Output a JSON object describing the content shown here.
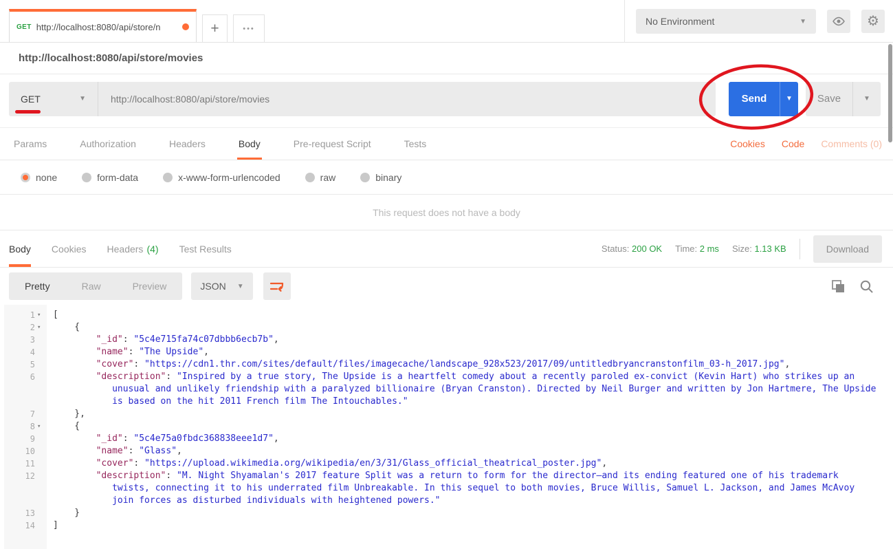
{
  "header": {
    "tab": {
      "method": "GET",
      "title": "http://localhost:8080/api/store/n",
      "unsaved_dot": true
    },
    "new_tab_label": "+",
    "more_tabs_label": "•••",
    "environment": {
      "selected": "No Environment"
    }
  },
  "breadcrumb": {
    "url": "http://localhost:8080/api/store/movies"
  },
  "request": {
    "method": "GET",
    "url": "http://localhost:8080/api/store/movies",
    "send_label": "Send",
    "save_label": "Save",
    "tabs": [
      {
        "label": "Params",
        "active": false
      },
      {
        "label": "Authorization",
        "active": false
      },
      {
        "label": "Headers",
        "active": false
      },
      {
        "label": "Body",
        "active": true
      },
      {
        "label": "Pre-request Script",
        "active": false
      },
      {
        "label": "Tests",
        "active": false
      }
    ],
    "meta_links": [
      {
        "label": "Cookies",
        "dim": false
      },
      {
        "label": "Code",
        "dim": false
      },
      {
        "label": "Comments (0)",
        "dim": true
      }
    ],
    "body_types": [
      {
        "label": "none",
        "selected": true
      },
      {
        "label": "form-data",
        "selected": false
      },
      {
        "label": "x-www-form-urlencoded",
        "selected": false
      },
      {
        "label": "raw",
        "selected": false
      },
      {
        "label": "binary",
        "selected": false
      }
    ],
    "empty_body_message": "This request does not have a body"
  },
  "response": {
    "tabs": [
      {
        "label": "Body",
        "count": "",
        "active": true
      },
      {
        "label": "Cookies",
        "count": "",
        "active": false
      },
      {
        "label": "Headers",
        "count": "(4)",
        "active": false
      },
      {
        "label": "Test Results",
        "count": "",
        "active": false
      }
    ],
    "status": {
      "label": "Status:",
      "value": "200 OK"
    },
    "time": {
      "label": "Time:",
      "value": "2 ms"
    },
    "size": {
      "label": "Size:",
      "value": "1.13 KB"
    },
    "download_label": "Download",
    "views": [
      {
        "label": "Pretty",
        "active": true
      },
      {
        "label": "Raw",
        "active": false
      },
      {
        "label": "Preview",
        "active": false
      }
    ],
    "format": "JSON"
  },
  "icons": {
    "environment_quicklook": "eye-icon",
    "settings": "gear-icon",
    "wrap_text": "wrap-text-icon",
    "copy": "copy-icon",
    "search": "search-icon"
  },
  "annotations": {
    "red_circle_target": "send-button",
    "red_underline_target": "method-select"
  },
  "colors": {
    "accent_orange": "#ff6c37",
    "send_blue": "#2b6fe3",
    "success_green": "#2ba143",
    "annotation_red": "#e0161f",
    "code_key": "#96265c",
    "code_string": "#2929cd"
  },
  "code": {
    "lines": [
      {
        "n": 1,
        "fold": true,
        "ind": 0,
        "cont": false,
        "t": [
          [
            "p",
            "["
          ]
        ]
      },
      {
        "n": 2,
        "fold": true,
        "ind": 4,
        "cont": false,
        "t": [
          [
            "p",
            "{"
          ]
        ]
      },
      {
        "n": 3,
        "fold": false,
        "ind": 8,
        "cont": false,
        "t": [
          [
            "k",
            "\"_id\""
          ],
          [
            "p",
            ": "
          ],
          [
            "s",
            "\"5c4e715fa74c07dbbb6ecb7b\""
          ],
          [
            "p",
            ","
          ]
        ]
      },
      {
        "n": 4,
        "fold": false,
        "ind": 8,
        "cont": false,
        "t": [
          [
            "k",
            "\"name\""
          ],
          [
            "p",
            ": "
          ],
          [
            "s",
            "\"The Upside\""
          ],
          [
            "p",
            ","
          ]
        ]
      },
      {
        "n": 5,
        "fold": false,
        "ind": 8,
        "cont": false,
        "t": [
          [
            "k",
            "\"cover\""
          ],
          [
            "p",
            ": "
          ],
          [
            "s",
            "\"https://cdn1.thr.com/sites/default/files/imagecache/landscape_928x523/2017/09/untitledbryancranstonfilm_03-h_2017.jpg\""
          ],
          [
            "p",
            ","
          ]
        ]
      },
      {
        "n": 6,
        "fold": false,
        "ind": 8,
        "cont": true,
        "t": [
          [
            "k",
            "\"description\""
          ],
          [
            "p",
            ": "
          ],
          [
            "s",
            "\"Inspired by a true story, The Upside is a heartfelt comedy about a recently paroled ex-convict (Kevin Hart) who strikes up an unusual and unlikely friendship with a paralyzed billionaire (Bryan Cranston). Directed by Neil Burger and written by Jon Hartmere, The Upside is based on the hit 2011 French film The Intouchables.\""
          ]
        ]
      },
      {
        "n": 7,
        "fold": false,
        "ind": 4,
        "cont": false,
        "t": [
          [
            "p",
            "},"
          ]
        ]
      },
      {
        "n": 8,
        "fold": true,
        "ind": 4,
        "cont": false,
        "t": [
          [
            "p",
            "{"
          ]
        ]
      },
      {
        "n": 9,
        "fold": false,
        "ind": 8,
        "cont": false,
        "t": [
          [
            "k",
            "\"_id\""
          ],
          [
            "p",
            ": "
          ],
          [
            "s",
            "\"5c4e75a0fbdc368838eee1d7\""
          ],
          [
            "p",
            ","
          ]
        ]
      },
      {
        "n": 10,
        "fold": false,
        "ind": 8,
        "cont": false,
        "t": [
          [
            "k",
            "\"name\""
          ],
          [
            "p",
            ": "
          ],
          [
            "s",
            "\"Glass\""
          ],
          [
            "p",
            ","
          ]
        ]
      },
      {
        "n": 11,
        "fold": false,
        "ind": 8,
        "cont": false,
        "t": [
          [
            "k",
            "\"cover\""
          ],
          [
            "p",
            ": "
          ],
          [
            "s",
            "\"https://upload.wikimedia.org/wikipedia/en/3/31/Glass_official_theatrical_poster.jpg\""
          ],
          [
            "p",
            ","
          ]
        ]
      },
      {
        "n": 12,
        "fold": false,
        "ind": 8,
        "cont": true,
        "t": [
          [
            "k",
            "\"description\""
          ],
          [
            "p",
            ": "
          ],
          [
            "s",
            "\"M. Night Shyamalan's 2017 feature Split was a return to form for the director—and its ending featured one of his trademark twists, connecting it to his underrated film Unbreakable. In this sequel to both movies, Bruce Willis, Samuel L. Jackson, and James McAvoy join forces as disturbed individuals with heightened powers.\""
          ]
        ]
      },
      {
        "n": 13,
        "fold": false,
        "ind": 4,
        "cont": false,
        "t": [
          [
            "p",
            "}"
          ]
        ]
      },
      {
        "n": 14,
        "fold": false,
        "ind": 0,
        "cont": false,
        "t": [
          [
            "p",
            "]"
          ]
        ]
      }
    ]
  }
}
